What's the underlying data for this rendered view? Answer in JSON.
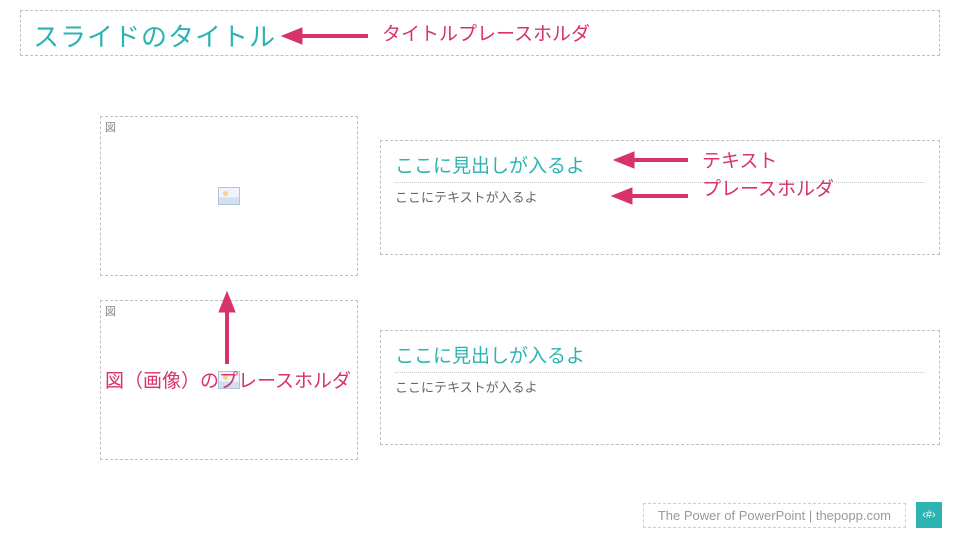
{
  "title": "スライドのタイトル",
  "figure_label": "図",
  "text_blocks": [
    {
      "heading": "ここに見出しが入るよ",
      "body": "ここにテキストが入るよ"
    },
    {
      "heading": "ここに見出しが入るよ",
      "body": "ここにテキストが入るよ"
    }
  ],
  "annotations": {
    "title": "タイトルプレースホルダ",
    "text1": "テキスト",
    "text2": "プレースホルダ",
    "figure": "図（画像）のプレースホルダ"
  },
  "footer": {
    "credit": "The Power of PowerPoint | thepopp.com",
    "page": "‹#›"
  }
}
